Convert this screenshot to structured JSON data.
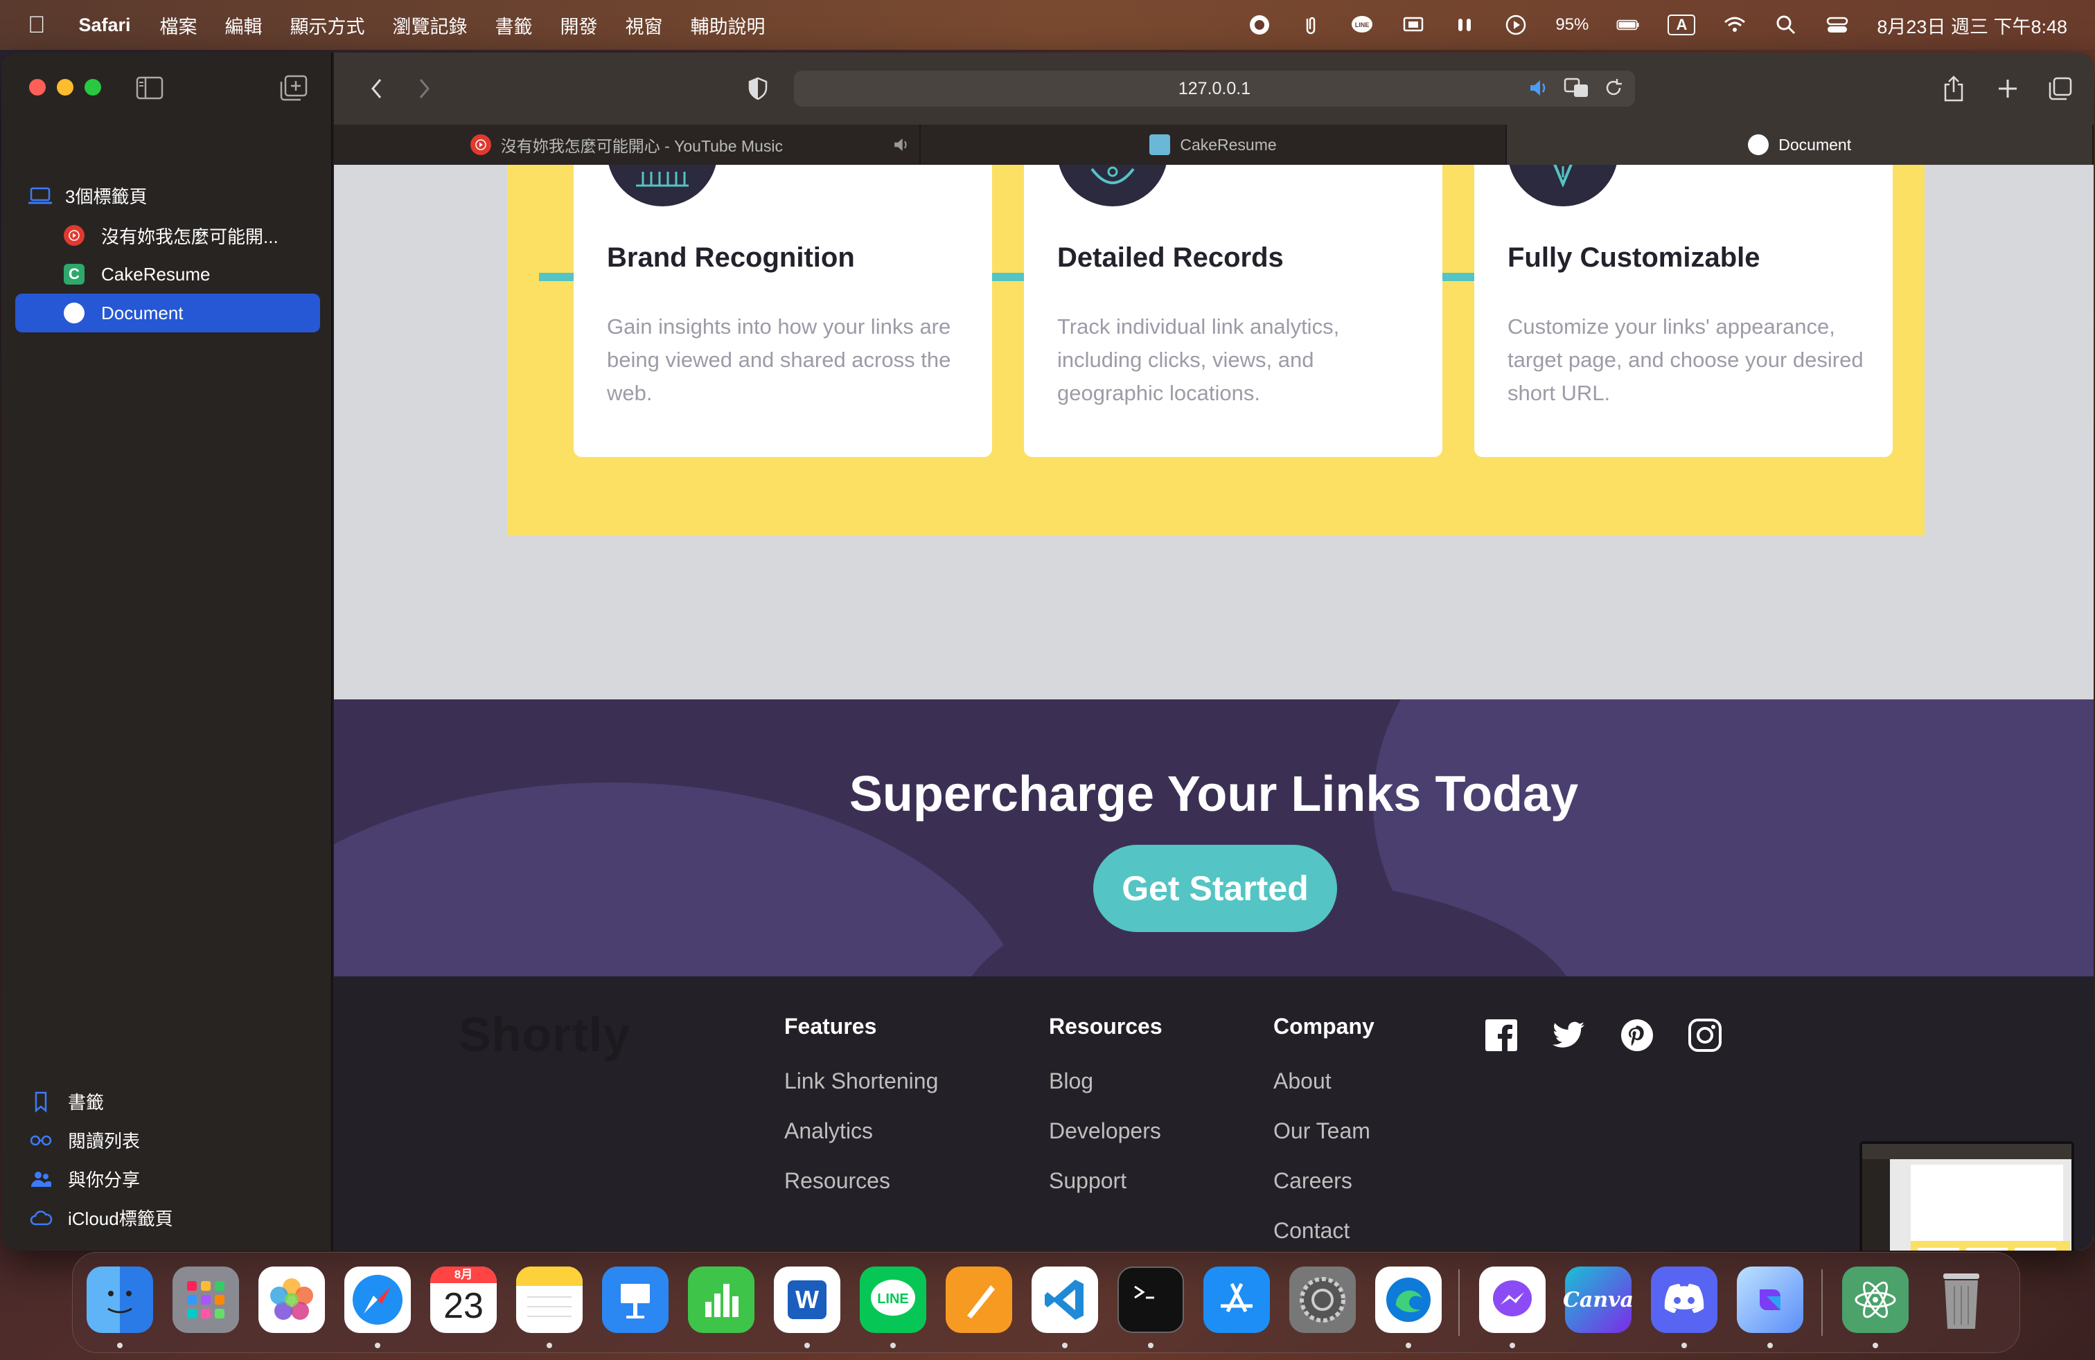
{
  "menubar": {
    "app_name": "Safari",
    "menus": [
      "檔案",
      "編輯",
      "顯示方式",
      "瀏覽記錄",
      "書籤",
      "開發",
      "視窗",
      "輔助說明"
    ],
    "battery": "95%",
    "input_method": "A",
    "datetime": "8月23日 週三 下午8:48"
  },
  "sidebar": {
    "group_label": "3個標籤頁",
    "tabs": [
      {
        "label": "沒有妳我怎麼可能開...",
        "color": "#e03a2f"
      },
      {
        "label": "CakeResume",
        "color": "#2fa86b"
      },
      {
        "label": "Document",
        "color": "#ffffff"
      }
    ],
    "bottom": [
      {
        "label": "書籤",
        "icon": "bookmark-icon"
      },
      {
        "label": "閱讀列表",
        "icon": "glasses-icon"
      },
      {
        "label": "與你分享",
        "icon": "shared-with-you-icon"
      },
      {
        "label": "iCloud標籤頁",
        "icon": "icloud-icon"
      }
    ]
  },
  "toolbar": {
    "address": "127.0.0.1"
  },
  "tabs": [
    {
      "label": "沒有妳我怎麼可能開心 - YouTube Music"
    },
    {
      "label": "CakeResume"
    },
    {
      "label": "Document"
    }
  ],
  "page": {
    "cards": [
      {
        "title": "Brand Recognition",
        "text": "Gain insights into how your links are being viewed and shared across the web."
      },
      {
        "title": "Detailed Records",
        "text": "Track individual link analytics, including clicks, views, and geographic locations."
      },
      {
        "title": "Fully Customizable",
        "text": "Customize your links' appearance, target page, and choose your desired short URL."
      }
    ],
    "cta_title": "Supercharge Your Links Today",
    "cta_button": "Get Started",
    "logo": "Shortly",
    "footer": {
      "features": {
        "title": "Features",
        "links": [
          "Link Shortening",
          "Analytics",
          "Resources"
        ]
      },
      "resources": {
        "title": "Resources",
        "links": [
          "Blog",
          "Developers",
          "Support"
        ]
      },
      "company": {
        "title": "Company",
        "links": [
          "About",
          "Our Team",
          "Careers",
          "Contact"
        ]
      }
    },
    "social": [
      "facebook-icon",
      "twitter-icon",
      "pinterest-icon",
      "instagram-icon"
    ]
  },
  "dock": {
    "calendar_month": "8月",
    "calendar_day": "23",
    "apps": [
      "Finder",
      "Launchpad",
      "Photos",
      "Safari",
      "Calendar",
      "Notes",
      "Keynote",
      "Numbers",
      "Word",
      "LINE",
      "Pages",
      "VS Code",
      "Terminal",
      "App Store",
      "System Settings",
      "Edge",
      "Messenger",
      "Canva",
      "Discord",
      "Copilot",
      "Atom",
      "Trash"
    ]
  },
  "colors": {
    "accent_cyan": "#54c4c4",
    "yellow": "#fbe063",
    "purple": "#3b3054",
    "footer_bg": "#232127",
    "safari_blue": "#2657d4"
  }
}
